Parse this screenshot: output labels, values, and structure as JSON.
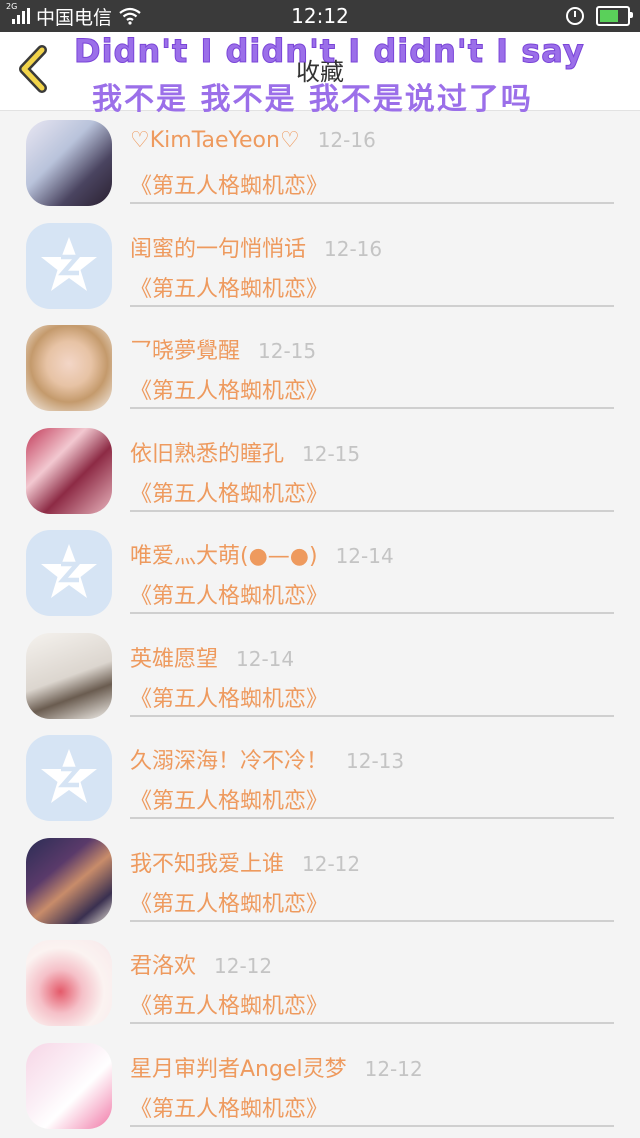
{
  "status_bar": {
    "network": "2G",
    "carrier": "中国电信",
    "time": "12:12"
  },
  "header": {
    "title": "收藏",
    "banner_en": "Didn't I didn't I didn't I say",
    "banner_zh": "我不是 我不是 我不是说过了吗"
  },
  "items": [
    {
      "name": "♡KimTaeYeon♡",
      "date": "12-16",
      "topic": "《第五人格蜘机恋》"
    },
    {
      "name": "闺蜜的一句悄悄话",
      "date": "12-16",
      "topic": "《第五人格蜘机恋》"
    },
    {
      "name": "乛晓夢覺醒",
      "date": "12-15",
      "topic": "《第五人格蜘机恋》"
    },
    {
      "name": "依旧熟悉的瞳孔",
      "date": "12-15",
      "topic": "《第五人格蜘机恋》"
    },
    {
      "name": "唯爱灬大萌(●—●)",
      "date": "12-14",
      "topic": "《第五人格蜘机恋》"
    },
    {
      "name": "英雄愿望",
      "date": "12-14",
      "topic": "《第五人格蜘机恋》"
    },
    {
      "name": "久溺深海！冷不冷！",
      "date": "12-13",
      "topic": "《第五人格蜘机恋》"
    },
    {
      "name": "我不知我爱上谁",
      "date": "12-12",
      "topic": "《第五人格蜘机恋》"
    },
    {
      "name": "君洛欢",
      "date": "12-12",
      "topic": "《第五人格蜘机恋》"
    },
    {
      "name": "星月审判者Angel灵梦",
      "date": "12-12",
      "topic": "《第五人格蜘机恋》"
    }
  ],
  "colors": {
    "accent_text": "#ee9a5e",
    "date_text": "#c4c4c4",
    "banner": "#9b6fe9",
    "back_arrow": "#f2d44a"
  }
}
